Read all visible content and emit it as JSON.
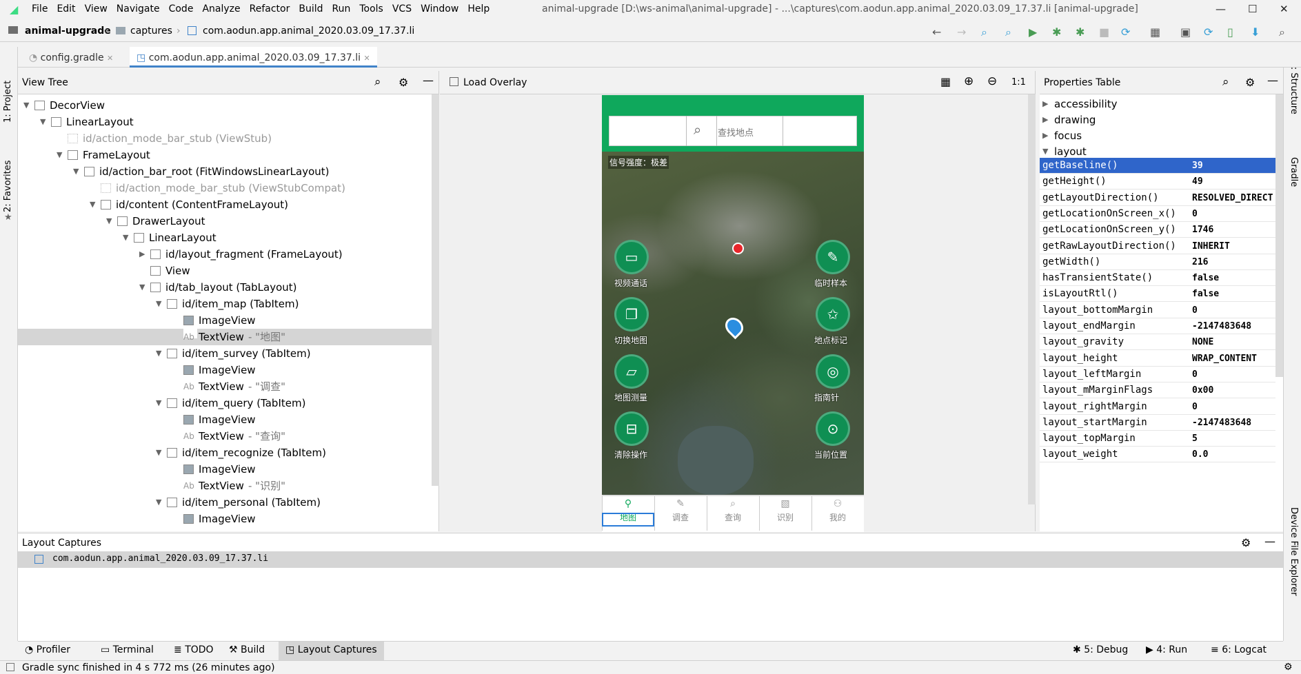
{
  "window": {
    "title": "animal-upgrade [D:\\ws-animal\\animal-upgrade] - ...\\captures\\com.aodun.app.animal_2020.03.09_17.37.li [animal-upgrade]",
    "menus": [
      "File",
      "Edit",
      "View",
      "Navigate",
      "Code",
      "Analyze",
      "Refactor",
      "Build",
      "Run",
      "Tools",
      "VCS",
      "Window",
      "Help"
    ]
  },
  "breadcrumb": {
    "project": "animal-upgrade",
    "folder": "captures",
    "file": "com.aodun.app.animal_2020.03.09_17.37.li"
  },
  "tabs": [
    {
      "label": "config.gradle"
    },
    {
      "label": "com.aodun.app.animal_2020.03.09_17.37.li"
    }
  ],
  "side": {
    "project": "1: Project",
    "favorites": "2: Favorites",
    "structure": "Z: Structure",
    "gradle": "Gradle",
    "device": "Device File Explorer"
  },
  "viewtree": {
    "title": "View Tree",
    "rows": [
      {
        "label": "DecorView",
        "sub": "",
        "depth": 0,
        "twisty": "▼",
        "dim": false
      },
      {
        "label": "LinearLayout",
        "sub": "",
        "depth": 1,
        "twisty": "▼",
        "dim": false
      },
      {
        "label": "id/action_mode_bar_stub (ViewStub)",
        "sub": "",
        "depth": 2,
        "twisty": "",
        "dim": true
      },
      {
        "label": "FrameLayout",
        "sub": "",
        "depth": 2,
        "twisty": "▼",
        "dim": false
      },
      {
        "label": "id/action_bar_root (FitWindowsLinearLayout)",
        "sub": "",
        "depth": 3,
        "twisty": "▼",
        "dim": false
      },
      {
        "label": "id/action_mode_bar_stub (ViewStubCompat)",
        "sub": "",
        "depth": 4,
        "twisty": "",
        "dim": true
      },
      {
        "label": "id/content (ContentFrameLayout)",
        "sub": "",
        "depth": 4,
        "twisty": "▼",
        "dim": false
      },
      {
        "label": "DrawerLayout",
        "sub": "",
        "depth": 5,
        "twisty": "▼",
        "dim": false
      },
      {
        "label": "LinearLayout",
        "sub": "",
        "depth": 6,
        "twisty": "▼",
        "dim": false
      },
      {
        "label": "id/layout_fragment (FrameLayout)",
        "sub": "",
        "depth": 7,
        "twisty": "▶",
        "dim": false
      },
      {
        "label": "View",
        "sub": "",
        "depth": 7,
        "twisty": "",
        "dim": false
      },
      {
        "label": "id/tab_layout (TabLayout)",
        "sub": "",
        "depth": 7,
        "twisty": "▼",
        "dim": false
      },
      {
        "label": "id/item_map (TabItem)",
        "sub": "",
        "depth": 8,
        "twisty": "▼",
        "dim": false
      },
      {
        "label": "ImageView",
        "sub": "",
        "depth": 9,
        "twisty": "",
        "dim": false
      },
      {
        "label": "TextView",
        "sub": " - \"地图\"",
        "depth": 9,
        "twisty": "",
        "dim": false,
        "sel": true
      },
      {
        "label": "id/item_survey (TabItem)",
        "sub": "",
        "depth": 8,
        "twisty": "▼",
        "dim": false
      },
      {
        "label": "ImageView",
        "sub": "",
        "depth": 9,
        "twisty": "",
        "dim": false
      },
      {
        "label": "TextView",
        "sub": " - \"调查\"",
        "depth": 9,
        "twisty": "",
        "dim": false
      },
      {
        "label": "id/item_query (TabItem)",
        "sub": "",
        "depth": 8,
        "twisty": "▼",
        "dim": false
      },
      {
        "label": "ImageView",
        "sub": "",
        "depth": 9,
        "twisty": "",
        "dim": false
      },
      {
        "label": "TextView",
        "sub": " - \"查询\"",
        "depth": 9,
        "twisty": "",
        "dim": false
      },
      {
        "label": "id/item_recognize (TabItem)",
        "sub": "",
        "depth": 8,
        "twisty": "▼",
        "dim": false
      },
      {
        "label": "ImageView",
        "sub": "",
        "depth": 9,
        "twisty": "",
        "dim": false
      },
      {
        "label": "TextView",
        "sub": " - \"识别\"",
        "depth": 9,
        "twisty": "",
        "dim": false
      },
      {
        "label": "id/item_personal (TabItem)",
        "sub": "",
        "depth": 8,
        "twisty": "▼",
        "dim": false
      },
      {
        "label": "ImageView",
        "sub": "",
        "depth": 9,
        "twisty": "",
        "dim": false
      }
    ]
  },
  "canvas": {
    "load_overlay": "Load Overlay",
    "zoom_actual": "1:1"
  },
  "phone": {
    "search_placeholder": "查找地点",
    "signal": "信号强度：极差",
    "left_buttons": [
      {
        "label": "视频通话",
        "icon": "video-icon"
      },
      {
        "label": "切换地图",
        "icon": "layers-icon"
      },
      {
        "label": "地图测量",
        "icon": "ruler-icon"
      },
      {
        "label": "清除操作",
        "icon": "basket-icon"
      }
    ],
    "right_buttons": [
      {
        "label": "临时样本",
        "icon": "note-icon"
      },
      {
        "label": "地点标记",
        "icon": "star-marker-icon"
      },
      {
        "label": "指南针",
        "icon": "compass-icon"
      },
      {
        "label": "当前位置",
        "icon": "locate-icon"
      }
    ],
    "nav_tabs": [
      "地图",
      "调查",
      "查询",
      "识别",
      "我的"
    ]
  },
  "properties": {
    "title": "Properties Table",
    "groups": [
      "accessibility",
      "drawing",
      "focus",
      "layout"
    ],
    "rows": [
      {
        "k": "getBaseline()",
        "v": "39",
        "sel": true
      },
      {
        "k": "getHeight()",
        "v": "49"
      },
      {
        "k": "getLayoutDirection()",
        "v": "RESOLVED_DIRECT"
      },
      {
        "k": "getLocationOnScreen_x()",
        "v": "0"
      },
      {
        "k": "getLocationOnScreen_y()",
        "v": "1746"
      },
      {
        "k": "getRawLayoutDirection()",
        "v": "INHERIT"
      },
      {
        "k": "getWidth()",
        "v": "216"
      },
      {
        "k": "hasTransientState()",
        "v": "false"
      },
      {
        "k": "isLayoutRtl()",
        "v": "false"
      },
      {
        "k": "layout_bottomMargin",
        "v": "0"
      },
      {
        "k": "layout_endMargin",
        "v": "-2147483648"
      },
      {
        "k": "layout_gravity",
        "v": "NONE"
      },
      {
        "k": "layout_height",
        "v": "WRAP_CONTENT"
      },
      {
        "k": "layout_leftMargin",
        "v": "0"
      },
      {
        "k": "layout_mMarginFlags",
        "v": "0x00"
      },
      {
        "k": "layout_rightMargin",
        "v": "0"
      },
      {
        "k": "layout_startMargin",
        "v": "-2147483648"
      },
      {
        "k": "layout_topMargin",
        "v": "5"
      },
      {
        "k": "layout_weight",
        "v": "0.0"
      }
    ]
  },
  "captures": {
    "title": "Layout Captures",
    "item": "com.aodun.app.animal_2020.03.09_17.37.li"
  },
  "bottom_tabs": {
    "profiler": "Profiler",
    "terminal": "Terminal",
    "todo": "TODO",
    "build": "Build",
    "layout_captures": "Layout Captures",
    "debug": "5: Debug",
    "run": "4: Run",
    "logcat": "6: Logcat"
  },
  "status": "Gradle sync finished in 4 s 772 ms (26 minutes ago)",
  "colors": {
    "accent": "#2f65ca",
    "phone_green": "#0f8f53",
    "tab_blue": "#4083c9"
  }
}
